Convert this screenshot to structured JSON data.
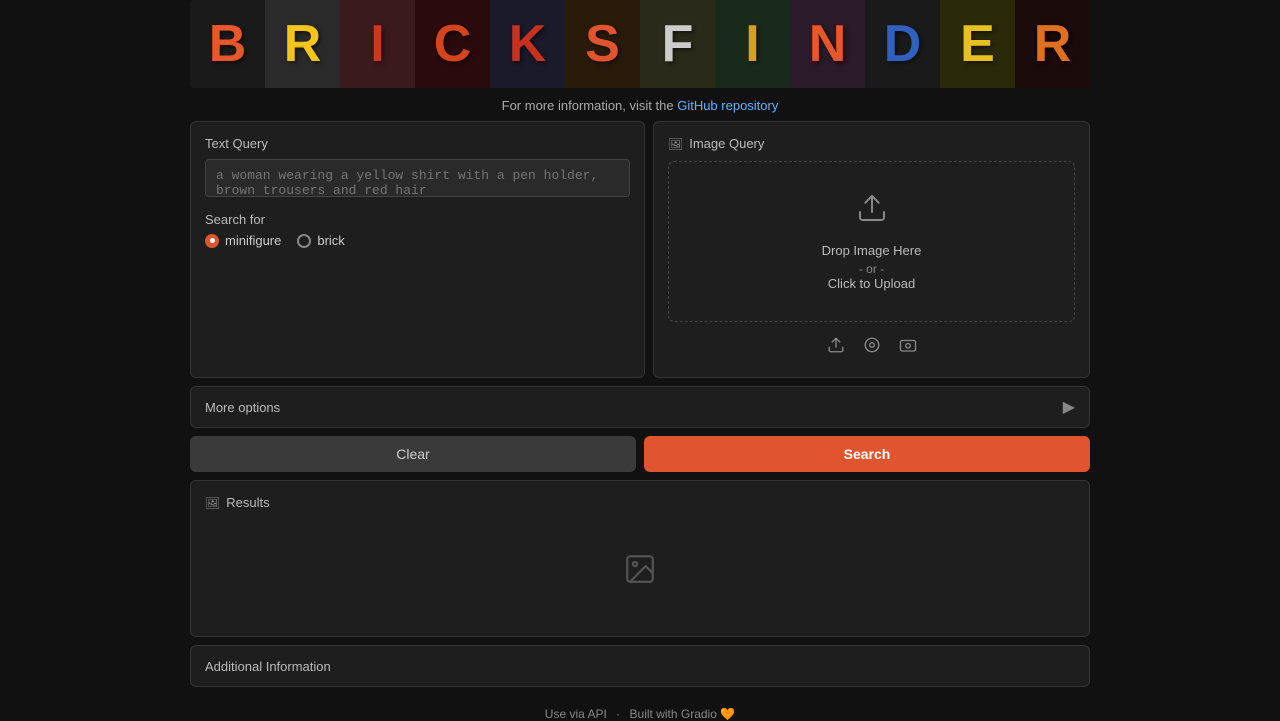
{
  "header": {
    "banner_letters": [
      {
        "char": "B",
        "cls": "bc-b"
      },
      {
        "char": "R",
        "cls": "bc-r"
      },
      {
        "char": "I",
        "cls": "bc-i"
      },
      {
        "char": "C",
        "cls": "bc-c"
      },
      {
        "char": "K",
        "cls": "bc-k"
      },
      {
        "char": "S",
        "cls": "bc-s"
      },
      {
        "char": "F",
        "cls": "bc-f"
      },
      {
        "char": "I",
        "cls": "bc-i2"
      },
      {
        "char": "N",
        "cls": "bc-n"
      },
      {
        "char": "D",
        "cls": "bc-d"
      },
      {
        "char": "E",
        "cls": "bc-e"
      },
      {
        "char": "R",
        "cls": "bc-r2"
      }
    ]
  },
  "info_line": {
    "text": "For more information, visit the ",
    "link_text": "GitHub repository",
    "link_href": "#"
  },
  "text_query": {
    "label": "Text Query",
    "placeholder": "a woman wearing a yellow shirt with a pen holder, brown trousers and red hair"
  },
  "search_for": {
    "label": "Search for",
    "options": [
      {
        "value": "minifigure",
        "label": "minifigure",
        "selected": true
      },
      {
        "value": "brick",
        "label": "brick",
        "selected": false
      }
    ]
  },
  "more_options": {
    "label": "More options"
  },
  "buttons": {
    "clear": "Clear",
    "search": "Search"
  },
  "image_query": {
    "label": "Image Query",
    "drop_text_1": "Drop Image Here",
    "drop_or": "- or -",
    "drop_click": "Click to Upload"
  },
  "results": {
    "label": "Results"
  },
  "additional_info": {
    "label": "Additional Information"
  },
  "footer": {
    "use_api": "Use via API",
    "built_with": "Built with Gradio",
    "emoji": "🧡"
  }
}
